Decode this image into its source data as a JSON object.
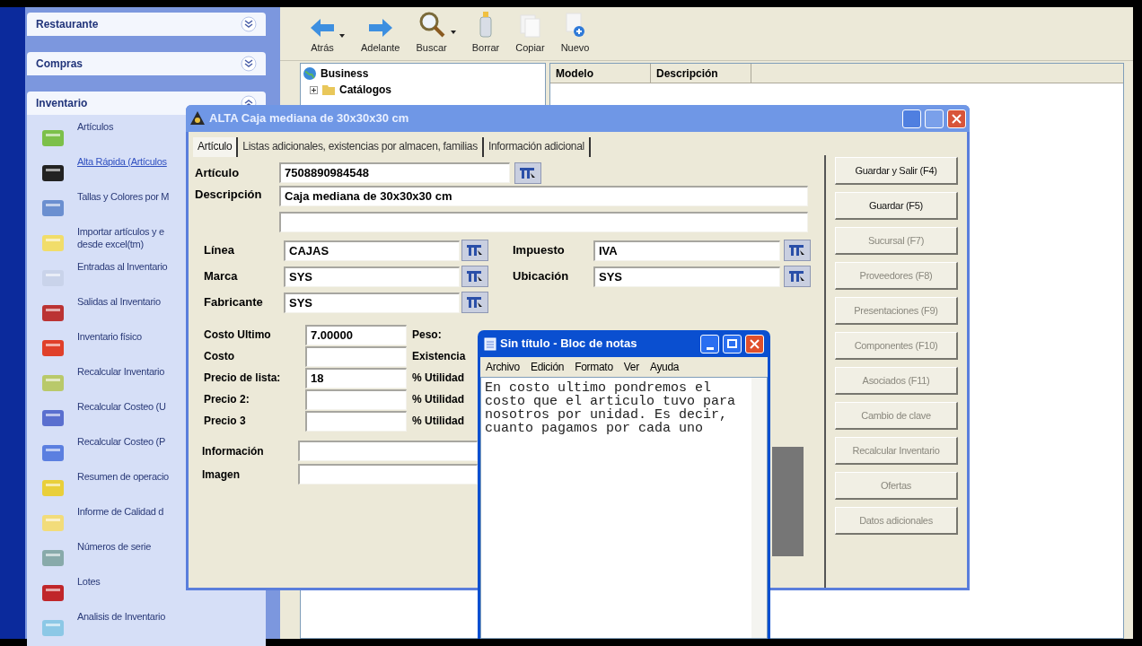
{
  "task_panel": {
    "groups": [
      {
        "title": "Restaurante",
        "expanded": false
      },
      {
        "title": "Compras",
        "expanded": false
      },
      {
        "title": "Inventario",
        "expanded": true,
        "items": [
          {
            "label": "Artículos",
            "hovered": false
          },
          {
            "label": "Alta Rápida (Artículos",
            "hovered": true
          },
          {
            "label": "Tallas y Colores por M",
            "hovered": false
          },
          {
            "label": "Importar artículos y e\ndesde excel(tm)",
            "hovered": false
          },
          {
            "label": "Entradas al Inventario",
            "hovered": false
          },
          {
            "label": "Salidas al Inventario",
            "hovered": false
          },
          {
            "label": "Inventario físico",
            "hovered": false
          },
          {
            "label": "Recalcular Inventario",
            "hovered": false
          },
          {
            "label": "Recalcular Costeo (U",
            "hovered": false
          },
          {
            "label": "Recalcular Costeo (P",
            "hovered": false
          },
          {
            "label": "Resumen de operacio",
            "hovered": false
          },
          {
            "label": "Informe de Calidad d",
            "hovered": false
          },
          {
            "label": "Números de serie",
            "hovered": false
          },
          {
            "label": "Lotes",
            "hovered": false
          },
          {
            "label": "Analisis de Inventario",
            "hovered": false
          }
        ]
      }
    ]
  },
  "explorer": {
    "toolbar": [
      {
        "label": "Atrás",
        "kind": "back",
        "dropdown": true
      },
      {
        "label": "Adelante",
        "kind": "forward",
        "dropdown": false
      },
      {
        "label": "Buscar",
        "kind": "search",
        "dropdown": true
      },
      {
        "label": "Borrar",
        "kind": "delete",
        "dropdown": false
      },
      {
        "label": "Copiar",
        "kind": "copy",
        "dropdown": false
      },
      {
        "label": "Nuevo",
        "kind": "new",
        "dropdown": false
      }
    ],
    "tree": [
      {
        "label": "Business",
        "children": [
          {
            "label": "Catálogos",
            "expanded": false
          }
        ]
      }
    ],
    "list": {
      "columns": [
        "Modelo",
        "Descripción"
      ]
    }
  },
  "dialog": {
    "title": "ALTA Caja mediana de 30x30x30 cm",
    "tabs": [
      {
        "label": "Artículo",
        "selected": true
      },
      {
        "label": "Listas adicionales, existencias por almacen, familias",
        "selected": false
      },
      {
        "label": "Información adicional",
        "selected": false
      }
    ],
    "articulo": {
      "label": "Artículo",
      "value": "7508890984548"
    },
    "descripcion": {
      "label": "Descripción",
      "value": "Caja mediana de 30x30x30 cm"
    },
    "lookups_left": [
      {
        "label": "Línea",
        "value": "CAJAS"
      },
      {
        "label": "Marca",
        "value": "SYS"
      },
      {
        "label": "Fabricante",
        "value": "SYS"
      }
    ],
    "lookups_right": [
      {
        "label": "Impuesto",
        "value": "IVA"
      },
      {
        "label": "Ubicación",
        "value": "SYS"
      }
    ],
    "prices": [
      {
        "label": "Costo Ultimo",
        "value": "7.00000",
        "side_label": "Peso:"
      },
      {
        "label": "Costo",
        "side_label": "Existencia"
      },
      {
        "label": "Precio de lista:",
        "value": "18",
        "side_label": "% Utilidad"
      },
      {
        "label": "Precio 2:",
        "side_label": "% Utilidad"
      },
      {
        "label": "Precio 3",
        "side_label": "% Utilidad"
      }
    ],
    "extra": [
      {
        "label": "Información"
      },
      {
        "label": "Imagen"
      }
    ],
    "buttons": [
      {
        "label": "Guardar y Salir (F4)",
        "disabled": false
      },
      {
        "label": "Guardar (F5)",
        "disabled": false
      },
      {
        "label": "Sucursal (F7)",
        "disabled": true
      },
      {
        "label": "Proveedores (F8)",
        "disabled": true
      },
      {
        "label": "Presentaciones (F9)",
        "disabled": true
      },
      {
        "label": "Componentes (F10)",
        "disabled": true
      },
      {
        "label": "Asociados (F11)",
        "disabled": true
      },
      {
        "label": "Cambio de clave",
        "disabled": true
      },
      {
        "label": "Recalcular Inventario",
        "disabled": true
      },
      {
        "label": "Ofertas",
        "disabled": true
      },
      {
        "label": "Datos adicionales",
        "disabled": true
      }
    ]
  },
  "notepad": {
    "title": "Sin título - Bloc de notas",
    "menu": [
      "Archivo",
      "Edición",
      "Formato",
      "Ver",
      "Ayuda"
    ],
    "text": "En costo ultimo pondremos el costo que el articulo tuvo para nosotros por unidad. Es decir, cuanto pagamos por cada uno"
  }
}
